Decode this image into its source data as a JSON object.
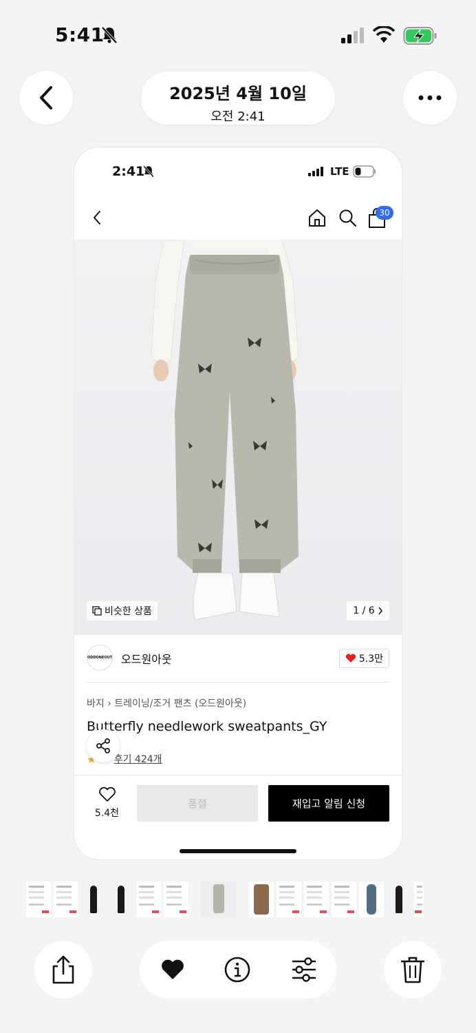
{
  "status_bar": {
    "time": "5:41",
    "silent_icon": "bell-slash-icon",
    "signal_icon": "cellular-signal-icon",
    "wifi_icon": "wifi-icon",
    "battery_icon": "battery-charging-icon"
  },
  "photos_nav": {
    "back_icon": "chevron-left-icon",
    "date": "2025년 4월 10일",
    "time": "오전 2:41",
    "more_icon": "ellipsis-icon"
  },
  "screenshot": {
    "status_bar": {
      "time": "2:41",
      "network": "LTE"
    },
    "app_bar": {
      "cart_count": "30"
    },
    "image": {
      "similar_label": "비슷한 상품",
      "counter": "1 / 6"
    },
    "brand": {
      "logo_text": "ODDONEOUT",
      "name": "오드원아웃",
      "likes": "5.3만"
    },
    "breadcrumb": {
      "category": "바지",
      "subcategory": "트레이닝/조거 팬츠 (오드원아웃)"
    },
    "product": {
      "title": "Butterfly needlework sweatpants_GY",
      "rating": ".8",
      "reviews": "후기 424개"
    },
    "actions": {
      "wish_count": "5.4천",
      "soldout_label": "품절",
      "restock_label": "재입고 알림 신청"
    }
  },
  "thumbnails": [
    "doc",
    "doc",
    "dark",
    "dark",
    "doc",
    "doc",
    "pants",
    "brown",
    "doc",
    "doc",
    "doc",
    "blue",
    "dark",
    "doc"
  ],
  "toolbar": {
    "share_icon": "share-icon",
    "heart_icon": "heart-icon",
    "info_icon": "info-icon",
    "adjust_icon": "sliders-icon",
    "trash_icon": "trash-icon"
  }
}
